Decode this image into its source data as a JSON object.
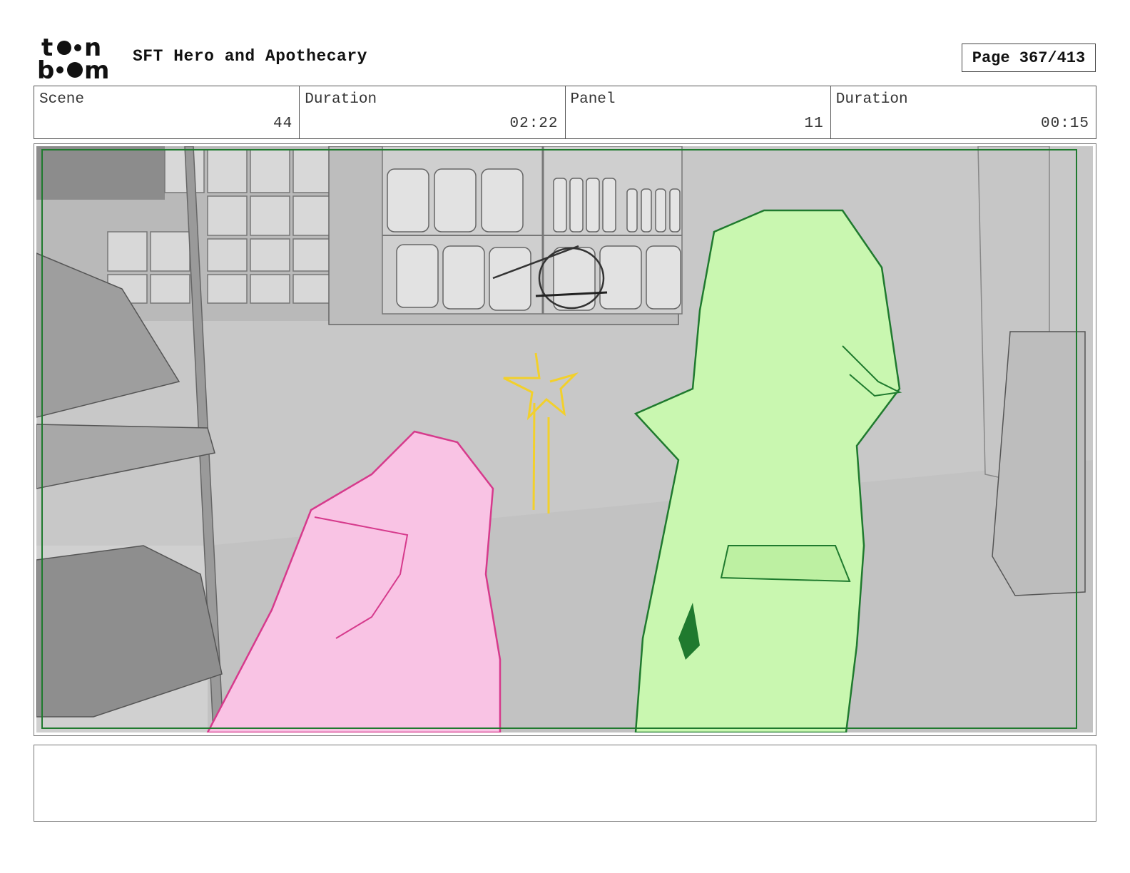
{
  "header": {
    "logo_text": "toon boom",
    "project_title": "SFT Hero and Apothecary",
    "page_label": "Page 367/413"
  },
  "info": [
    {
      "label": "Scene",
      "value": "44"
    },
    {
      "label": "Duration",
      "value": "02:22"
    },
    {
      "label": "Panel",
      "value": "11"
    },
    {
      "label": "Duration",
      "value": "00:15"
    }
  ],
  "panel": {
    "frame_color": "#1f7a2e",
    "character_left_color": "#f9c3e4",
    "character_right_color": "#c9f7b0",
    "sparkle_color": "#f2d02c"
  },
  "notes": {
    "text": ""
  }
}
